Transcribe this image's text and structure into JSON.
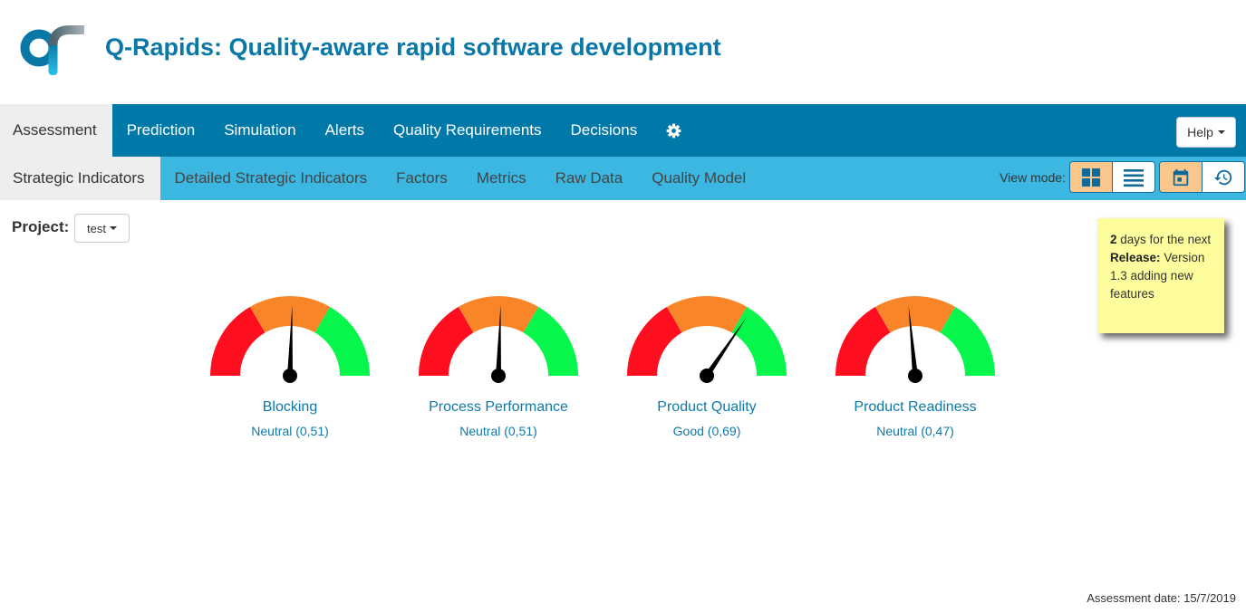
{
  "app": {
    "title": "Q-Rapids: Quality-aware rapid software development",
    "logo_icon": "q-rapids-logo"
  },
  "colors": {
    "brand": "#0a78a6",
    "nav_bg": "#0079a8",
    "subnav_bg": "#3bb7e2",
    "active_tab_bg": "#eeeeee",
    "active_view_button": "#fbc68c",
    "note_bg": "#fefd9e",
    "gauge_label": "#0e79a8"
  },
  "nav": {
    "items": [
      {
        "label": "Assessment",
        "active": true
      },
      {
        "label": "Prediction",
        "active": false
      },
      {
        "label": "Simulation",
        "active": false
      },
      {
        "label": "Alerts",
        "active": false
      },
      {
        "label": "Quality Requirements",
        "active": false
      },
      {
        "label": "Decisions",
        "active": false
      }
    ],
    "settings_icon": "gear-icon",
    "help_label": "Help"
  },
  "subnav": {
    "items": [
      {
        "label": "Strategic Indicators",
        "active": true
      },
      {
        "label": "Detailed Strategic Indicators",
        "active": false
      },
      {
        "label": "Factors",
        "active": false
      },
      {
        "label": "Metrics",
        "active": false
      },
      {
        "label": "Raw Data",
        "active": false
      },
      {
        "label": "Quality Model",
        "active": false
      }
    ],
    "view_mode_label": "View mode:",
    "view_buttons": [
      {
        "icon": "grid-icon",
        "active": true
      },
      {
        "icon": "list-icon",
        "active": false
      },
      {
        "icon": "calendar-icon",
        "active": true
      },
      {
        "icon": "history-icon",
        "active": false
      }
    ]
  },
  "project": {
    "label": "Project:",
    "selected": "test"
  },
  "release_note": {
    "days": "2",
    "days_text": "days for the next",
    "release_label": "Release:",
    "release_desc": "Version 1.3 adding new features"
  },
  "main": {
    "gauge_scale": {
      "min": 0,
      "max": 1,
      "bands": [
        {
          "from": 0,
          "to": 0.333,
          "color": "#ff0e1f"
        },
        {
          "from": 0.333,
          "to": 0.667,
          "color": "#f98529"
        },
        {
          "from": 0.667,
          "to": 1,
          "color": "#06f64b"
        }
      ],
      "needle_color": "#000000"
    },
    "gauges": [
      {
        "name": "Blocking",
        "status": "Neutral",
        "value": 0.51,
        "status_text": "Neutral (0,51)"
      },
      {
        "name": "Process Performance",
        "status": "Neutral",
        "value": 0.51,
        "status_text": "Neutral (0,51)"
      },
      {
        "name": "Product Quality",
        "status": "Good",
        "value": 0.69,
        "status_text": "Good (0,69)"
      },
      {
        "name": "Product Readiness",
        "status": "Neutral",
        "value": 0.47,
        "status_text": "Neutral (0,47)"
      }
    ]
  },
  "footer": {
    "assessment_date": "Assessment date: 15/7/2019"
  }
}
